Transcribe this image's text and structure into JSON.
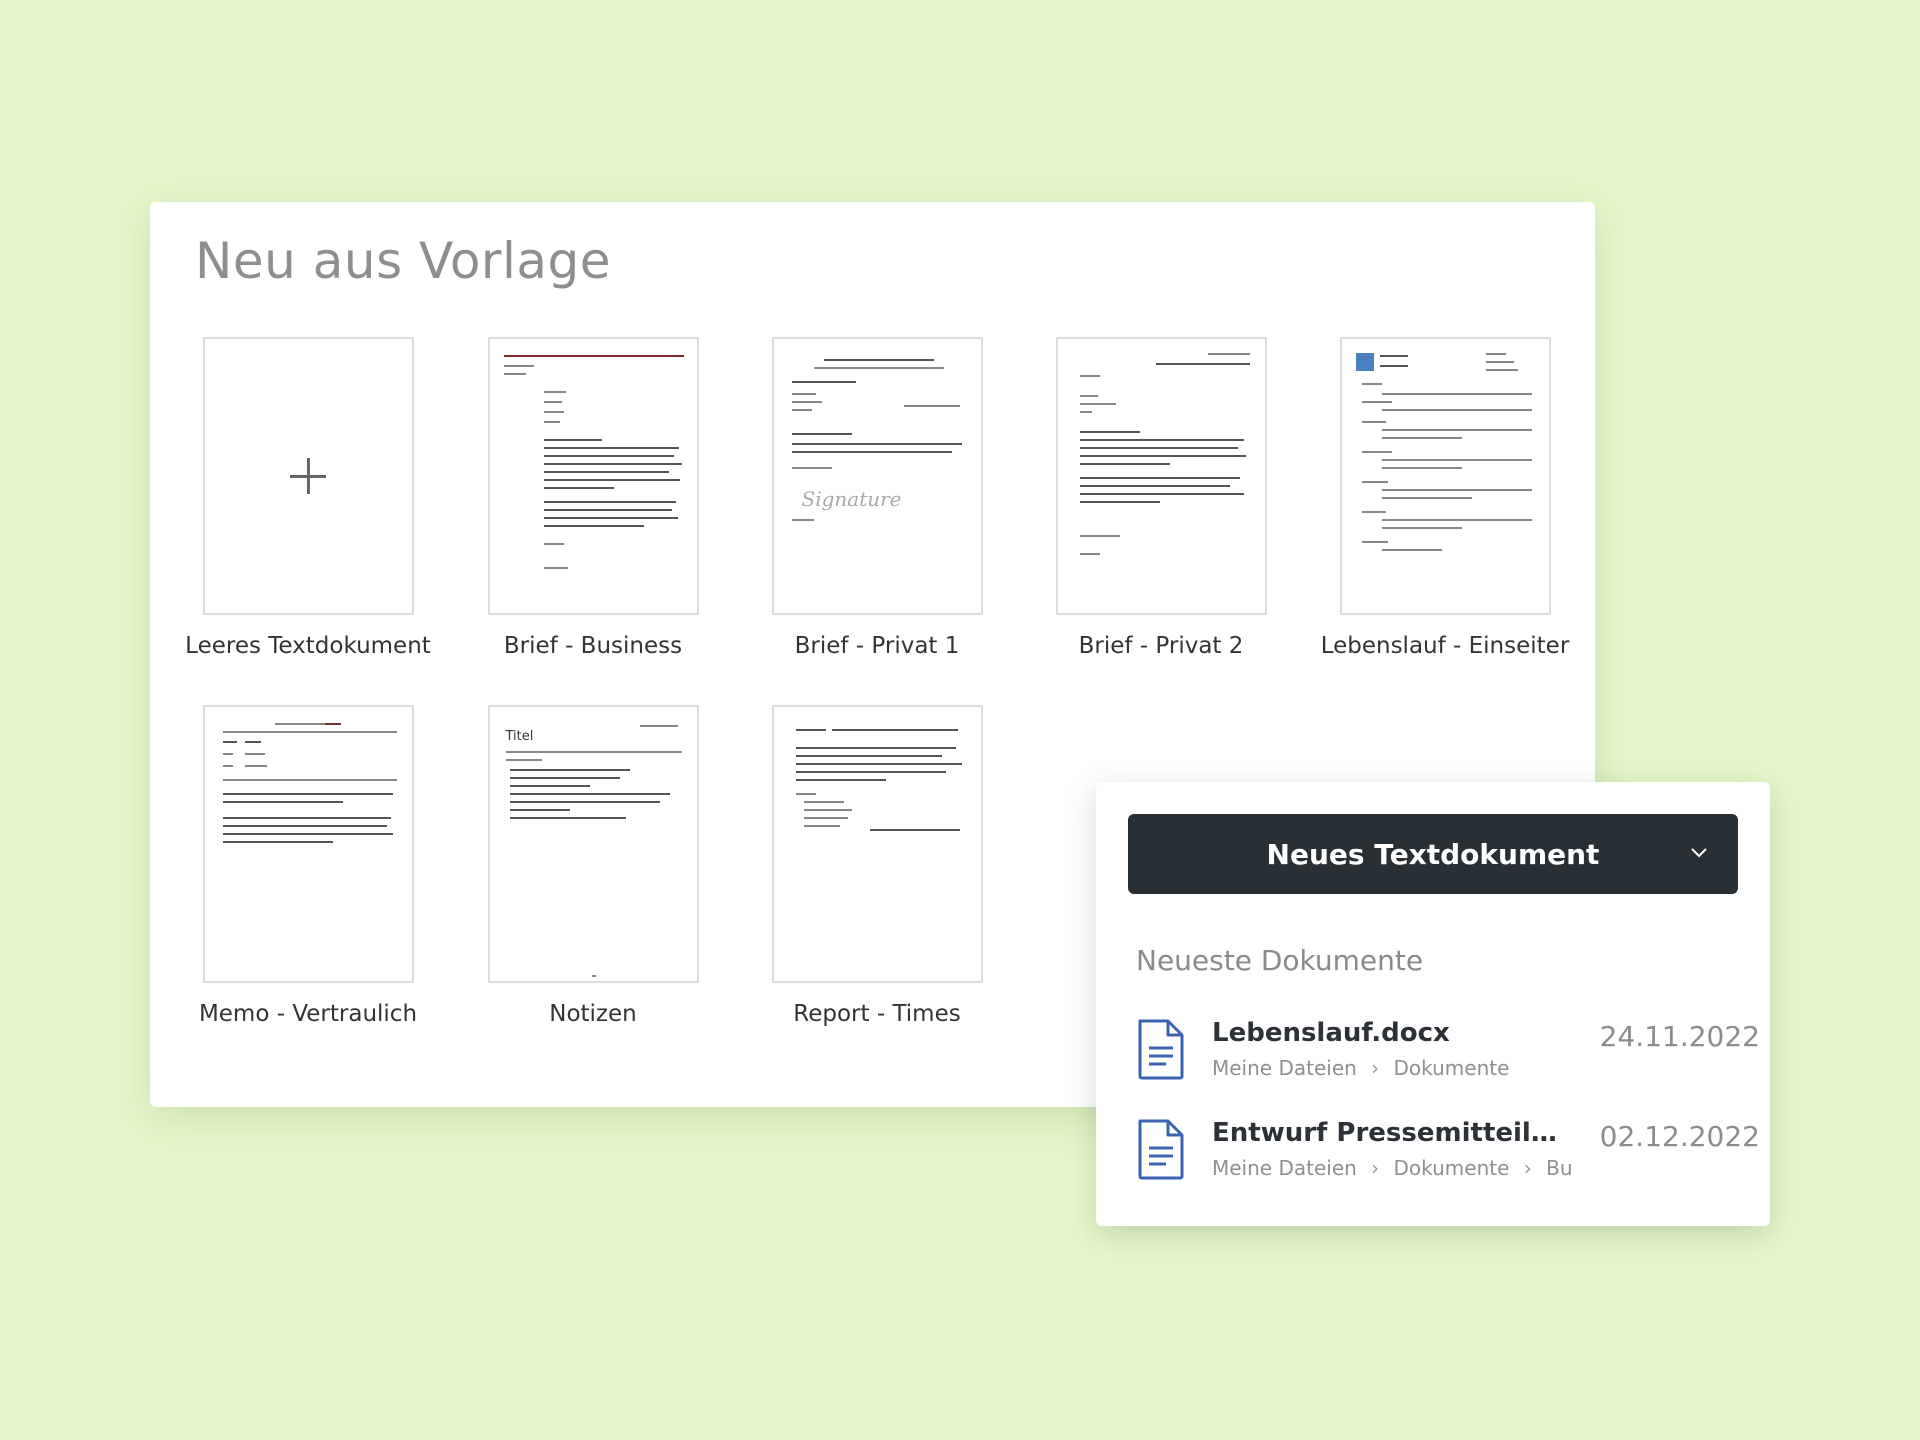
{
  "template_panel": {
    "title": "Neu aus Vorlage",
    "templates": [
      {
        "label": "Leeres Textdokument"
      },
      {
        "label": "Brief - Business"
      },
      {
        "label": "Brief - Privat 1"
      },
      {
        "label": "Brief - Privat 2"
      },
      {
        "label": "Lebenslauf - Einseiter"
      },
      {
        "label": "Memo - Vertraulich"
      },
      {
        "label": "Notizen",
        "thumb_title": "Titel"
      },
      {
        "label": "Report - Times"
      }
    ]
  },
  "documents_panel": {
    "new_button_label": "Neues Textdokument",
    "recent_heading": "Neueste Dokumente",
    "recent": [
      {
        "name": "Lebenslauf.docx",
        "path": [
          "Meine Dateien",
          "Dokumente"
        ],
        "date": "24.11.2022"
      },
      {
        "name": "Entwurf Pressemitteilung....",
        "path": [
          "Meine Dateien",
          "Dokumente",
          "Bu..."
        ],
        "date": "02.12.2022"
      }
    ]
  },
  "colors": {
    "background": "#e5f8cb",
    "button": "#283036",
    "file_icon": "#3b63b3"
  },
  "icons": [
    "plus-icon",
    "chevron-down-icon",
    "document-icon",
    "chevron-right-icon"
  ]
}
